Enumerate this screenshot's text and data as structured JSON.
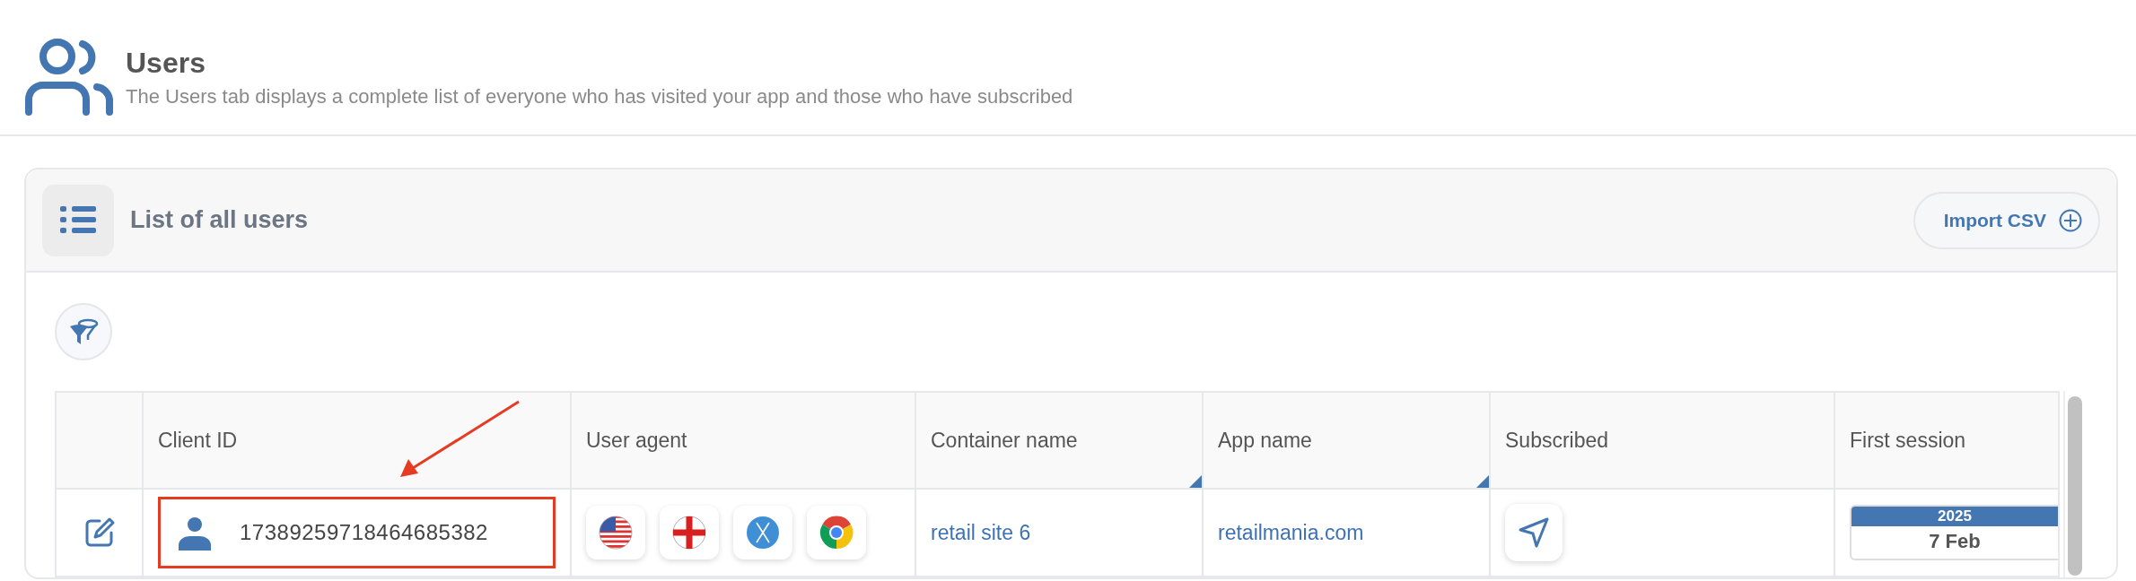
{
  "header": {
    "title": "Users",
    "subtitle": "The Users tab displays a complete list of everyone who has visited your app and those who have subscribed"
  },
  "card": {
    "title": "List of all users",
    "import_button": "Import CSV"
  },
  "table": {
    "columns": [
      {
        "corner_marker": false
      },
      {
        "label": "Client ID",
        "corner_marker": false
      },
      {
        "label": "User agent",
        "corner_marker": false
      },
      {
        "label": "Container name",
        "corner_marker": true
      },
      {
        "label": "App name",
        "corner_marker": true
      },
      {
        "label": "Subscribed",
        "corner_marker": false
      },
      {
        "label": "First session",
        "corner_marker": false
      }
    ],
    "rows": [
      {
        "client_id": "17389259718464685382",
        "highlighted": true,
        "agents": [
          {
            "kind": "flag-us"
          },
          {
            "kind": "flag-england"
          },
          {
            "kind": "os-x"
          },
          {
            "kind": "browser"
          }
        ],
        "container": "retail site 6",
        "app": "retailmania.com",
        "subscribed": true,
        "first_session": {
          "year": "2025",
          "day": "7 Feb"
        }
      }
    ]
  }
}
